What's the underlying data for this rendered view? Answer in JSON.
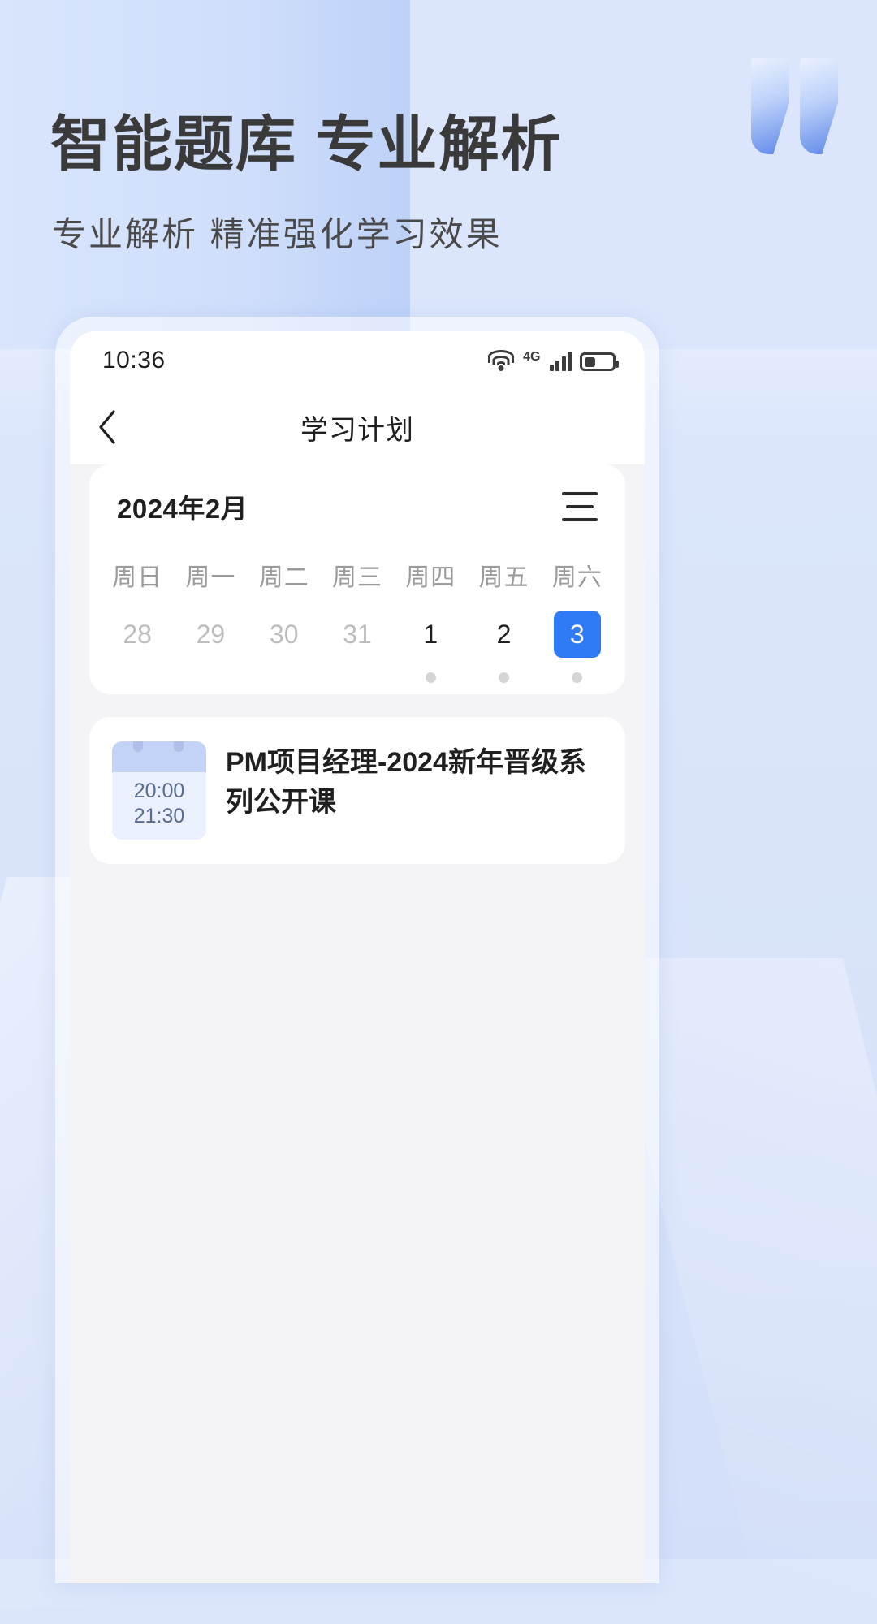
{
  "promo": {
    "headline": "智能题库 专业解析",
    "subhead": "专业解析 精准强化学习效果",
    "accent_color": "#5e88e8",
    "bg_color": "#dbe6fb",
    "quote_icon": "quote-mark-icon"
  },
  "phone": {
    "status_bar": {
      "time": "10:36",
      "wifi_icon": "wifi-icon",
      "network_label": "4G",
      "signal_icon": "cellular-signal-icon",
      "battery_icon": "battery-icon"
    },
    "nav": {
      "back_icon": "chevron-left-icon",
      "title": "学习计划"
    },
    "calendar": {
      "month_label": "2024年2月",
      "menu_icon": "hamburger-menu-icon",
      "weekdays": [
        "周日",
        "周一",
        "周二",
        "周三",
        "周四",
        "周五",
        "周六"
      ],
      "days": [
        {
          "num": "28",
          "state": "muted",
          "dot": false
        },
        {
          "num": "29",
          "state": "muted",
          "dot": false
        },
        {
          "num": "30",
          "state": "muted",
          "dot": false
        },
        {
          "num": "31",
          "state": "muted",
          "dot": false
        },
        {
          "num": "1",
          "state": "normal",
          "dot": true
        },
        {
          "num": "2",
          "state": "normal",
          "dot": true
        },
        {
          "num": "3",
          "state": "active",
          "dot": true
        }
      ],
      "selected_day": "3",
      "selected_color": "#2f7bf6"
    },
    "schedule": [
      {
        "start_time": "20:00",
        "end_time": "21:30",
        "title": "PM项目经理-2024新年晋级系列公开课",
        "badge_icon": "calendar-badge-icon"
      }
    ]
  }
}
